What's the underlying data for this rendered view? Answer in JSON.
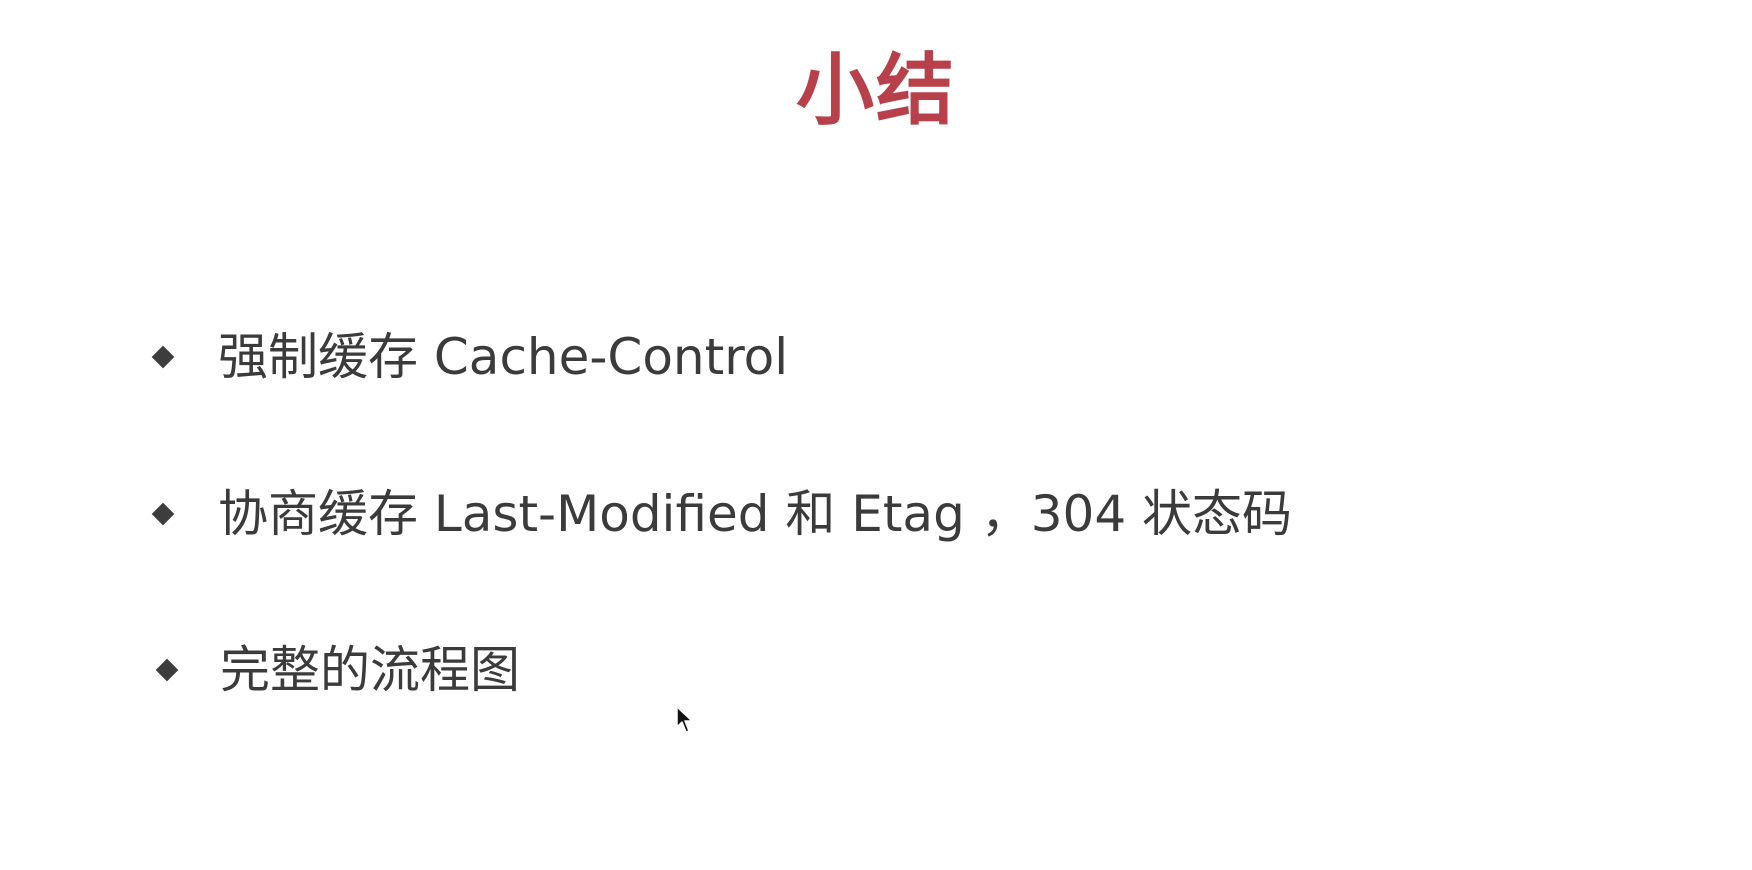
{
  "slide": {
    "title": "小结",
    "bullets": [
      {
        "text": "强制缓存 Cache-Control"
      },
      {
        "text": "协商缓存 Last-Modified 和 Etag ，304 状态码"
      },
      {
        "text": "完整的流程图"
      }
    ]
  },
  "colors": {
    "title": "#b8404b",
    "body_text": "#3b3b3b",
    "bullet_marker": "#3d3d3d",
    "background": "#ffffff"
  },
  "icons": {
    "bullet": "diamond-bullet-icon",
    "pointer": "mouse-cursor-icon"
  }
}
